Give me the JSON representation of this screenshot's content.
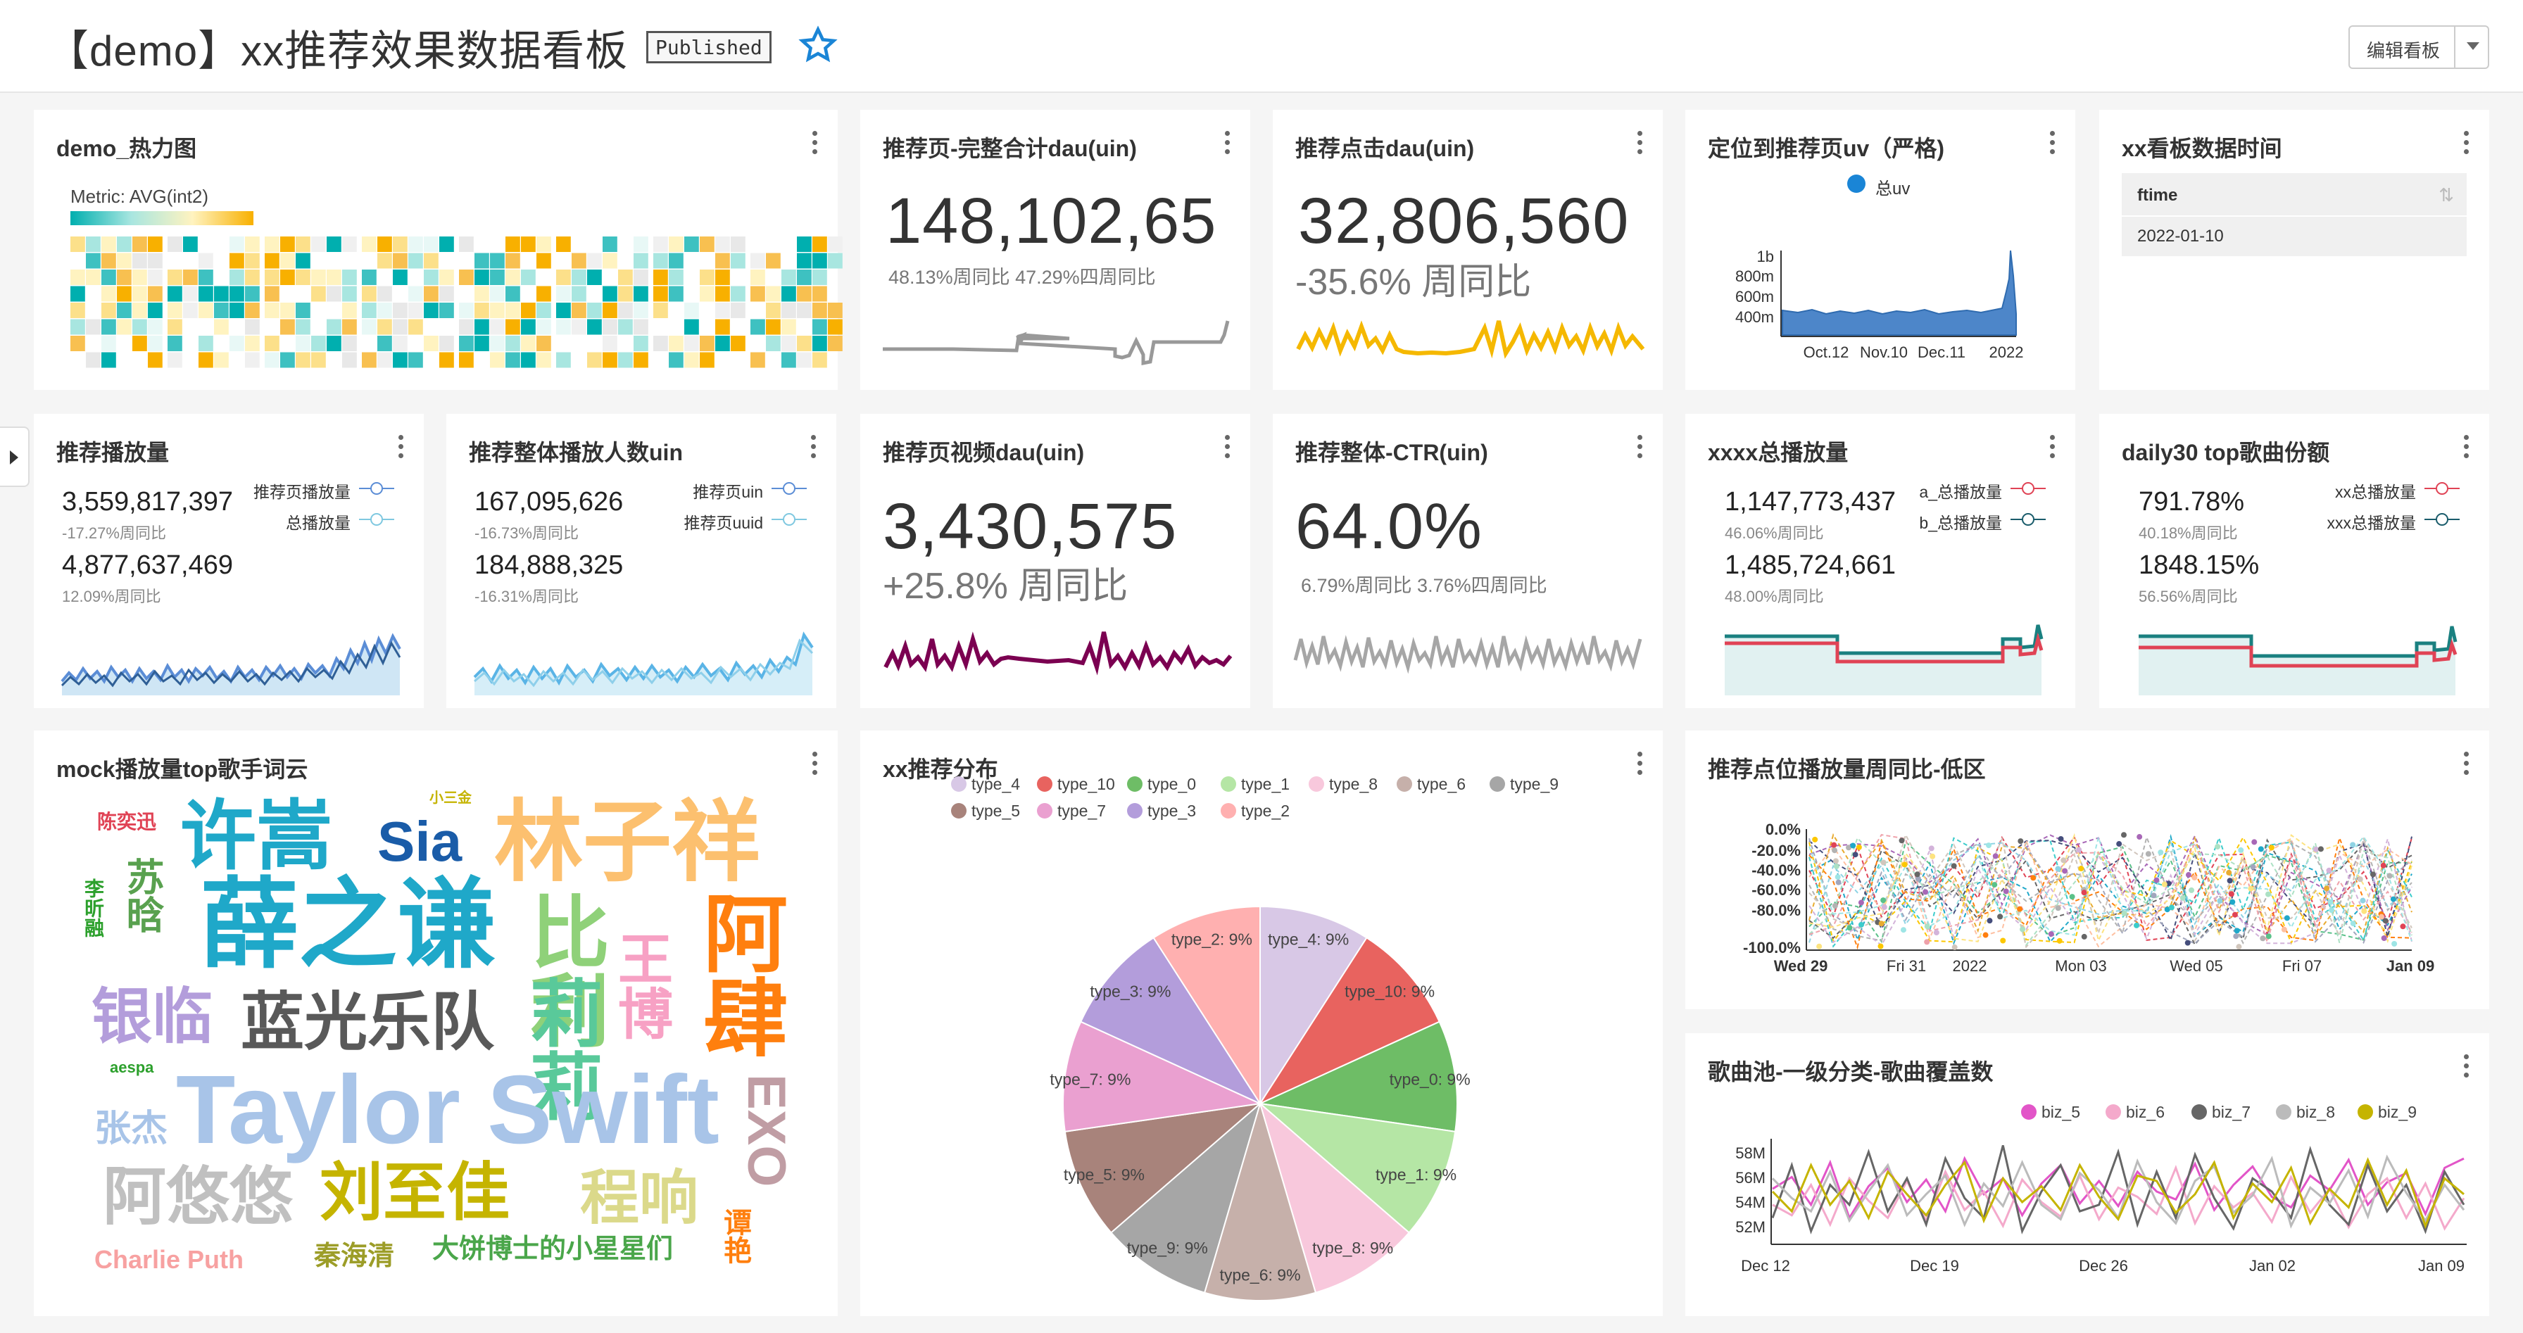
{
  "header": {
    "title": "【demo】xx推荐效果数据看板",
    "badge": "Published",
    "edit_label": "编辑看板"
  },
  "colors": {
    "accent": "#1A85A0",
    "teal": "#20B2AA",
    "line_red": "#E04355",
    "line_teal": "#1A8080",
    "yellow": "#F5B800",
    "maroon": "#7B0051",
    "grey": "#A6A6A6",
    "blue": "#5AC8FA"
  },
  "cards": {
    "heatmap": {
      "title": "demo_热力图",
      "metric": "Metric: AVG(int2)"
    },
    "c1": {
      "title": "推荐页-完整合计dau(uin)",
      "value": "148,102,65",
      "sub": "48.13%周同比  47.29%四周同比"
    },
    "c2": {
      "title": "推荐点击dau(uin)",
      "value": "32,806,560",
      "sub": "-35.6% 周同比"
    },
    "c3": {
      "title": "定位到推荐页uv（严格)",
      "legend": "总uv",
      "yticks": [
        "1b",
        "800m",
        "600m",
        "400m"
      ],
      "xticks": [
        "Oct.12",
        "Nov.10",
        "Dec.11",
        "2022"
      ]
    },
    "c4": {
      "title": "xx看板数据时间",
      "col": "ftime",
      "value": "2022-01-10"
    },
    "c5": {
      "title": "推荐播放量",
      "rows": [
        {
          "value": "3,559,817,397",
          "pct": "-17.27%周同比",
          "legend": "推荐页播放量"
        },
        {
          "value": "4,877,637,469",
          "pct": "12.09%周同比",
          "legend": "总播放量"
        }
      ]
    },
    "c6": {
      "title": "推荐整体播放人数uin",
      "rows": [
        {
          "value": "167,095,626",
          "pct": "-16.73%周同比",
          "legend": "推荐页uin"
        },
        {
          "value": "184,888,325",
          "pct": "-16.31%周同比",
          "legend": "推荐页uuid"
        }
      ]
    },
    "c7": {
      "title": "推荐页视频dau(uin)",
      "value": "3,430,575",
      "sub": "+25.8% 周同比"
    },
    "c8": {
      "title": "推荐整体-CTR(uin)",
      "value": "64.0%",
      "sub": "6.79%周同比  3.76%四周同比"
    },
    "c9": {
      "title": "xxxx总播放量",
      "rows": [
        {
          "value": "1,147,773,437",
          "pct": "46.06%周同比",
          "legend": "a_总播放量"
        },
        {
          "value": "1,485,724,661",
          "pct": "48.00%周同比",
          "legend": "b_总播放量"
        }
      ]
    },
    "c10": {
      "title": "daily30 top歌曲份额",
      "rows": [
        {
          "value": "791.78%",
          "pct": "40.18%周同比",
          "legend": "xx总播放量"
        },
        {
          "value": "1848.15%",
          "pct": "56.56%周同比",
          "legend": "xxx总播放量"
        }
      ]
    },
    "c11": {
      "title": "mock播放量top歌手词云"
    },
    "c12": {
      "title": "xx推荐分布"
    },
    "c13": {
      "title": "推荐点位播放量周同比-低区",
      "yticks": [
        "0.0%",
        "-20.0%",
        "-40.0%",
        "-60.0%",
        "-80.0%",
        "-100.0%"
      ],
      "xticks": [
        "Wed 29",
        "Fri 31",
        "2022",
        "Mon 03",
        "Wed 05",
        "Fri 07",
        "Jan 09"
      ]
    },
    "c14": {
      "title": "歌曲池-一级分类-歌曲覆盖数",
      "yticks": [
        "58M",
        "56M",
        "54M",
        "52M"
      ],
      "xticks": [
        "Dec 12",
        "Dec 19",
        "Dec 26",
        "Jan 02",
        "Jan 09"
      ],
      "legend": [
        "biz_5",
        "biz_6",
        "biz_7",
        "biz_8",
        "biz_9"
      ]
    }
  },
  "wordcloud": [
    {
      "text": "陈奕迅",
      "color": "#E04355"
    },
    {
      "text": "许嵩",
      "color": "#1FA8C9"
    },
    {
      "text": "Sia",
      "color": "#1A5CA8"
    },
    {
      "text": "小三金",
      "color": "#C5B400"
    },
    {
      "text": "林子祥",
      "color": "#FCC06F"
    },
    {
      "text": "苏晗",
      "color": "#59A14F"
    },
    {
      "text": "李昕融",
      "color": "#2CA02C"
    },
    {
      "text": "薛之谦",
      "color": "#1FA8C9"
    },
    {
      "text": "比利",
      "color": "#8FD179"
    },
    {
      "text": "王博",
      "color": "#F7A1C4"
    },
    {
      "text": "阿肆",
      "color": "#FF7F0E"
    },
    {
      "text": "银临",
      "color": "#B39DDB"
    },
    {
      "text": "蓝光乐队",
      "color": "#595959"
    },
    {
      "text": "莉莉",
      "color": "#59C99A"
    },
    {
      "text": "aespa",
      "color": "#2CA02C"
    },
    {
      "text": "Taylor Swift",
      "color": "#A8C4E8"
    },
    {
      "text": "EXO",
      "color": "#C09DA4"
    },
    {
      "text": "张杰",
      "color": "#A8C4E8"
    },
    {
      "text": "阿悠悠",
      "color": "#C0C0C0"
    },
    {
      "text": "刘至佳",
      "color": "#C5B400"
    },
    {
      "text": "程响",
      "color": "#DBD98A"
    },
    {
      "text": "Charlie Puth",
      "color": "#F7A1A1"
    },
    {
      "text": "秦海清",
      "color": "#9C9D28"
    },
    {
      "text": "大饼博士的小星星们",
      "color": "#4AA64A"
    },
    {
      "text": "谭艳",
      "color": "#FF7F0E"
    }
  ],
  "chart_data": [
    {
      "type": "pie",
      "title": "xx推荐分布",
      "series": [
        {
          "name": "type_4",
          "value": 9,
          "color": "#D8C8E6"
        },
        {
          "name": "type_10",
          "value": 9,
          "color": "#E8635F"
        },
        {
          "name": "type_0",
          "value": 9,
          "color": "#6EBD66"
        },
        {
          "name": "type_1",
          "value": 9,
          "color": "#B5E6A5"
        },
        {
          "name": "type_8",
          "value": 9,
          "color": "#F8C8DC"
        },
        {
          "name": "type_6",
          "value": 9,
          "color": "#C6B0AA"
        },
        {
          "name": "type_9",
          "value": 9,
          "color": "#A6A6A6"
        },
        {
          "name": "type_5",
          "value": 9,
          "color": "#A8837B"
        },
        {
          "name": "type_7",
          "value": 9,
          "color": "#EAA0D0"
        },
        {
          "name": "type_3",
          "value": 9,
          "color": "#B39DDB"
        },
        {
          "name": "type_2",
          "value": 9,
          "color": "#FFB0B0"
        }
      ],
      "legend_order": [
        "type_4",
        "type_10",
        "type_0",
        "type_1",
        "type_8",
        "type_6",
        "type_9",
        "type_5",
        "type_7",
        "type_3",
        "type_2"
      ]
    },
    {
      "type": "line",
      "title": "歌曲池-一级分类-歌曲覆盖数",
      "ylim": [
        51,
        59
      ],
      "x": [
        "Dec 12",
        "Jan 09"
      ],
      "series": [
        {
          "name": "biz_5",
          "color": "#E255C8",
          "values": [
            55.2,
            56.1,
            54.0,
            57.2,
            53.0,
            55.4,
            56.8,
            54.2,
            55.9,
            53.5,
            57.5,
            54.8,
            56.0,
            53.2,
            55.6,
            57.0,
            54.1,
            55.8,
            53.9,
            56.5,
            55.0,
            54.4,
            57.1,
            53.6,
            55.5,
            56.9,
            54.6,
            53.8,
            56.2,
            55.1,
            57.4,
            54.0,
            55.7,
            56.4,
            53.3,
            56.8,
            57.5
          ]
        },
        {
          "name": "biz_6",
          "color": "#F4A9CB",
          "values": [
            54.0,
            53.2,
            55.5,
            52.5,
            56.0,
            54.3,
            53.0,
            55.8,
            52.8,
            56.5,
            53.6,
            55.0,
            52.4,
            55.9,
            54.2,
            53.1,
            56.2,
            52.9,
            55.3,
            54.6,
            53.3,
            56.8,
            52.6,
            55.4,
            53.8,
            54.9,
            52.7,
            56.1,
            53.4,
            55.2,
            52.3,
            54.8,
            56.0,
            53.0,
            55.6,
            52.2,
            54.5
          ]
        },
        {
          "name": "biz_7",
          "color": "#666666",
          "values": [
            53.0,
            57.0,
            52.0,
            55.5,
            54.0,
            58.0,
            53.5,
            56.0,
            52.5,
            57.5,
            54.5,
            53.0,
            58.5,
            52.0,
            55.0,
            57.0,
            53.5,
            54.0,
            58.0,
            52.5,
            56.5,
            53.0,
            57.8,
            54.5,
            52.2,
            56.0,
            55.0,
            53.0,
            58.2,
            54.0,
            52.5,
            57.0,
            53.5,
            55.5,
            52.0,
            56.5,
            54.0
          ]
        },
        {
          "name": "biz_8",
          "color": "#BBBBBB",
          "values": [
            56.0,
            54.5,
            53.5,
            56.5,
            52.8,
            55.0,
            57.0,
            53.2,
            54.8,
            56.2,
            52.5,
            55.6,
            53.9,
            57.2,
            54.0,
            52.9,
            56.4,
            55.1,
            53.0,
            57.3,
            54.2,
            52.6,
            55.8,
            56.9,
            53.4,
            54.7,
            57.5,
            52.4,
            55.3,
            54.1,
            56.6,
            53.1,
            57.6,
            54.9,
            52.8,
            55.5,
            53.6
          ]
        },
        {
          "name": "biz_9",
          "color": "#C5B400",
          "values": [
            55.0,
            53.5,
            57.0,
            54.0,
            55.8,
            53.0,
            56.5,
            54.8,
            53.2,
            55.5,
            57.2,
            52.8,
            56.0,
            54.2,
            55.4,
            53.6,
            57.0,
            54.6,
            52.9,
            56.2,
            55.8,
            53.4,
            54.8,
            57.2,
            53.0,
            55.6,
            54.2,
            56.8,
            52.6,
            55.2,
            53.8,
            57.4,
            54.0,
            56.6,
            52.4,
            56.0,
            54.8
          ]
        }
      ]
    },
    {
      "type": "line",
      "title": "推荐点位播放量周同比-低区",
      "ylim": [
        -100,
        0
      ],
      "x": [
        "Wed 29",
        "Jan 09"
      ],
      "note": "dense multi-series dashed lines"
    }
  ]
}
